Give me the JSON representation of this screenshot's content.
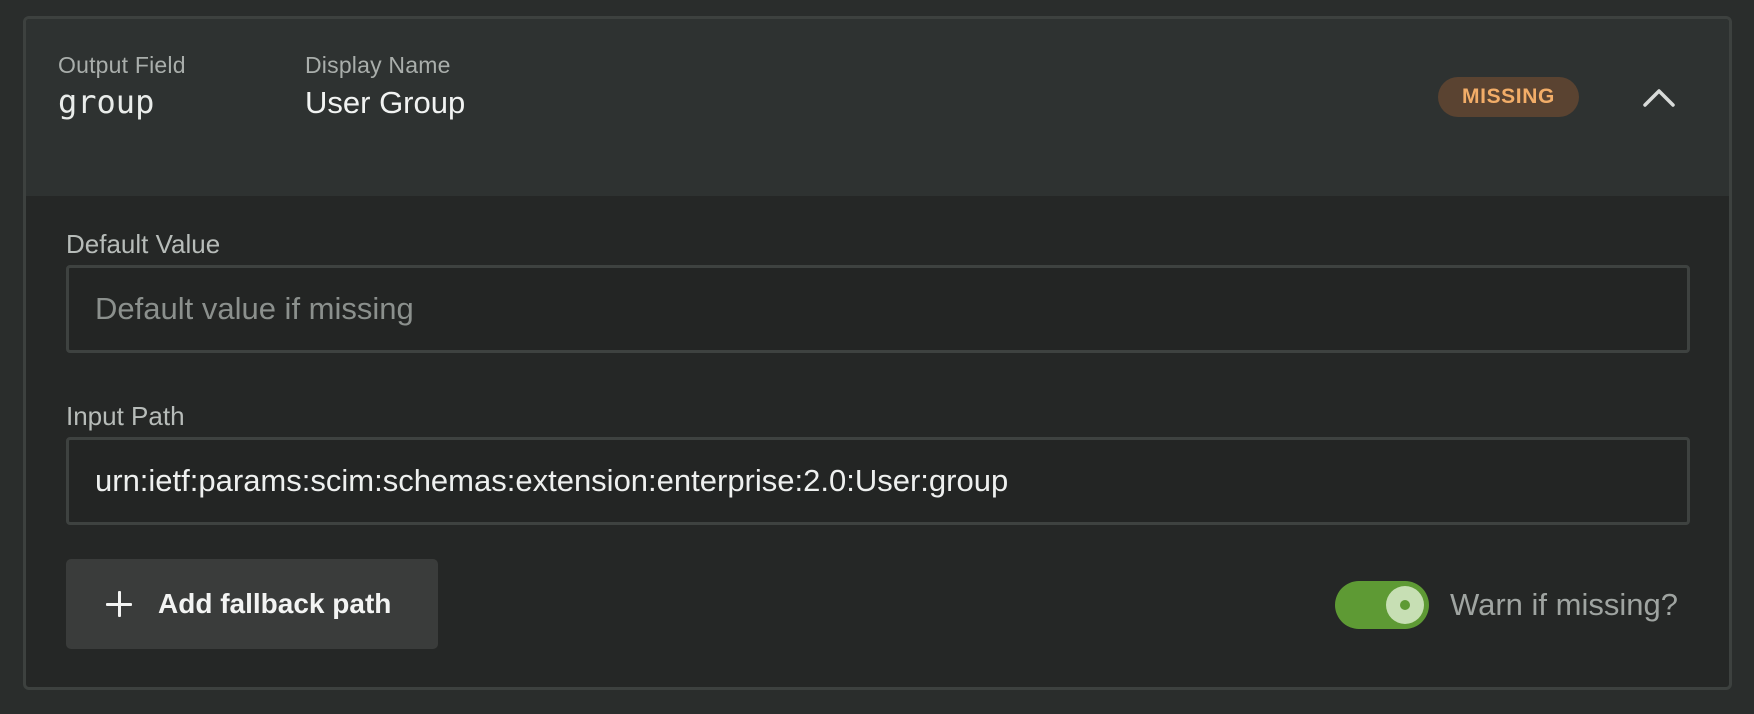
{
  "header": {
    "output_field_label": "Output Field",
    "output_field_value": "group",
    "display_name_label": "Display Name",
    "display_name_value": "User Group",
    "status_badge": "MISSING",
    "collapse_icon": "chevron-up-icon"
  },
  "default_value": {
    "label": "Default Value",
    "value": "",
    "placeholder": "Default value if missing"
  },
  "input_path": {
    "label": "Input Path",
    "value": "urn:ietf:params:scim:schemas:extension:enterprise:2.0:User:group",
    "placeholder": ""
  },
  "actions": {
    "add_fallback_label": "Add fallback path",
    "add_icon": "plus-icon",
    "warn_label": "Warn if missing?",
    "warn_enabled": true
  },
  "colors": {
    "badge_text": "#f2ad68",
    "badge_bg": "#5a4331",
    "toggle_on": "#5e9a34"
  }
}
